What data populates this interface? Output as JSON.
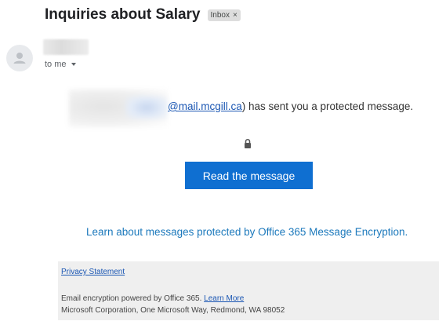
{
  "email": {
    "subject": "Inquiries about Salary",
    "label": "Inbox",
    "label_close": "×",
    "recipient": "to me"
  },
  "message": {
    "sender_email_visible": "@mail.mcgill.ca",
    "sent_close_paren": ")",
    "sent_text": " has sent you a protected message.",
    "read_button": "Read the message",
    "learn_link": "Learn about messages protected by Office 365 Message Encryption."
  },
  "footer": {
    "privacy": "Privacy Statement",
    "powered_text": "Email encryption powered by Office 365. ",
    "learn_more": "Learn More",
    "address": "Microsoft Corporation, One Microsoft Way, Redmond, WA 98052"
  },
  "colors": {
    "button_bg": "#0f6fd1",
    "link": "#1c79bc",
    "footer_bg": "#efefef"
  }
}
